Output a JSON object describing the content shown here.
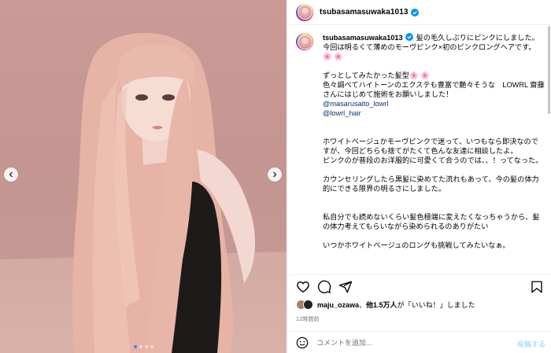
{
  "post": {
    "username": "tsubasamasuwaka1013",
    "verified": true,
    "photo_alt": "pink long hair portrait",
    "carousel": {
      "total": 4,
      "active": 1
    }
  },
  "caption": {
    "username": "tsubasamasuwaka1013",
    "paragraphs": [
      "髪の毛久しぶりにピンクにしました。今回は明るくて薄めのモーヴピンク×初のピンクロングヘアです。",
      "ずっとしてみたかった髪型",
      "色々調べてハイトーンのエクステも豊富で艶々そうな　LOWRL 齋藤さんにはじめて施術をお願いしました！",
      "ホワイトベージュかモーヴピンクで迷って、いつもなら即決なのですが、今回どちらも捨てがたくて色んな友達に相談したよ。\nピンクのが普段のお洋服的に可愛くて合うのでは、、！ってなった。",
      "カウンセリングしたら黒髪に染めてた流れもあって、今の髪の体力的にできる限界の明るさにしました。",
      "私自分でも読めないくらい髪色極端に変えたくなっちゃうから、髪の体力考えてもらいながら染められるのありがたい",
      "いつかホワイトベージュのロングも挑戦してみたいなぁ。"
    ],
    "flowers": "🌸 🌸",
    "mentions": [
      "@masarusaito_lowrl",
      "@lowrl_hair"
    ]
  },
  "likes": {
    "user": "maju_ozawa",
    "others": "他1.5万人",
    "suffix": "が「いいね！」しました",
    "separator": "、"
  },
  "timestamp": "12時間前",
  "comment": {
    "placeholder": "コメントを追加...",
    "post_label": "投稿する"
  },
  "colors": {
    "accent": "#0095f6",
    "mention": "#00376b",
    "muted": "#737373"
  },
  "icons": [
    "verified-badge-icon",
    "heart-icon",
    "comment-icon",
    "share-icon",
    "bookmark-icon",
    "emoji-icon",
    "chevron-left-icon",
    "chevron-right-icon"
  ]
}
